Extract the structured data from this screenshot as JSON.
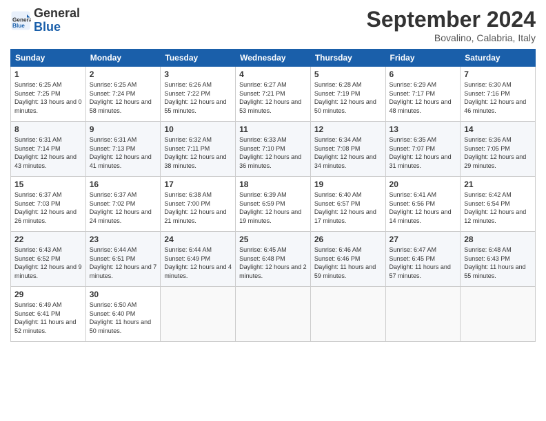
{
  "header": {
    "logo_general": "General",
    "logo_blue": "Blue",
    "month_title": "September 2024",
    "location": "Bovalino, Calabria, Italy"
  },
  "days_of_week": [
    "Sunday",
    "Monday",
    "Tuesday",
    "Wednesday",
    "Thursday",
    "Friday",
    "Saturday"
  ],
  "weeks": [
    [
      {
        "day": "1",
        "sunrise": "Sunrise: 6:25 AM",
        "sunset": "Sunset: 7:25 PM",
        "daylight": "Daylight: 13 hours and 0 minutes."
      },
      {
        "day": "2",
        "sunrise": "Sunrise: 6:25 AM",
        "sunset": "Sunset: 7:24 PM",
        "daylight": "Daylight: 12 hours and 58 minutes."
      },
      {
        "day": "3",
        "sunrise": "Sunrise: 6:26 AM",
        "sunset": "Sunset: 7:22 PM",
        "daylight": "Daylight: 12 hours and 55 minutes."
      },
      {
        "day": "4",
        "sunrise": "Sunrise: 6:27 AM",
        "sunset": "Sunset: 7:21 PM",
        "daylight": "Daylight: 12 hours and 53 minutes."
      },
      {
        "day": "5",
        "sunrise": "Sunrise: 6:28 AM",
        "sunset": "Sunset: 7:19 PM",
        "daylight": "Daylight: 12 hours and 50 minutes."
      },
      {
        "day": "6",
        "sunrise": "Sunrise: 6:29 AM",
        "sunset": "Sunset: 7:17 PM",
        "daylight": "Daylight: 12 hours and 48 minutes."
      },
      {
        "day": "7",
        "sunrise": "Sunrise: 6:30 AM",
        "sunset": "Sunset: 7:16 PM",
        "daylight": "Daylight: 12 hours and 46 minutes."
      }
    ],
    [
      {
        "day": "8",
        "sunrise": "Sunrise: 6:31 AM",
        "sunset": "Sunset: 7:14 PM",
        "daylight": "Daylight: 12 hours and 43 minutes."
      },
      {
        "day": "9",
        "sunrise": "Sunrise: 6:31 AM",
        "sunset": "Sunset: 7:13 PM",
        "daylight": "Daylight: 12 hours and 41 minutes."
      },
      {
        "day": "10",
        "sunrise": "Sunrise: 6:32 AM",
        "sunset": "Sunset: 7:11 PM",
        "daylight": "Daylight: 12 hours and 38 minutes."
      },
      {
        "day": "11",
        "sunrise": "Sunrise: 6:33 AM",
        "sunset": "Sunset: 7:10 PM",
        "daylight": "Daylight: 12 hours and 36 minutes."
      },
      {
        "day": "12",
        "sunrise": "Sunrise: 6:34 AM",
        "sunset": "Sunset: 7:08 PM",
        "daylight": "Daylight: 12 hours and 34 minutes."
      },
      {
        "day": "13",
        "sunrise": "Sunrise: 6:35 AM",
        "sunset": "Sunset: 7:07 PM",
        "daylight": "Daylight: 12 hours and 31 minutes."
      },
      {
        "day": "14",
        "sunrise": "Sunrise: 6:36 AM",
        "sunset": "Sunset: 7:05 PM",
        "daylight": "Daylight: 12 hours and 29 minutes."
      }
    ],
    [
      {
        "day": "15",
        "sunrise": "Sunrise: 6:37 AM",
        "sunset": "Sunset: 7:03 PM",
        "daylight": "Daylight: 12 hours and 26 minutes."
      },
      {
        "day": "16",
        "sunrise": "Sunrise: 6:37 AM",
        "sunset": "Sunset: 7:02 PM",
        "daylight": "Daylight: 12 hours and 24 minutes."
      },
      {
        "day": "17",
        "sunrise": "Sunrise: 6:38 AM",
        "sunset": "Sunset: 7:00 PM",
        "daylight": "Daylight: 12 hours and 21 minutes."
      },
      {
        "day": "18",
        "sunrise": "Sunrise: 6:39 AM",
        "sunset": "Sunset: 6:59 PM",
        "daylight": "Daylight: 12 hours and 19 minutes."
      },
      {
        "day": "19",
        "sunrise": "Sunrise: 6:40 AM",
        "sunset": "Sunset: 6:57 PM",
        "daylight": "Daylight: 12 hours and 17 minutes."
      },
      {
        "day": "20",
        "sunrise": "Sunrise: 6:41 AM",
        "sunset": "Sunset: 6:56 PM",
        "daylight": "Daylight: 12 hours and 14 minutes."
      },
      {
        "day": "21",
        "sunrise": "Sunrise: 6:42 AM",
        "sunset": "Sunset: 6:54 PM",
        "daylight": "Daylight: 12 hours and 12 minutes."
      }
    ],
    [
      {
        "day": "22",
        "sunrise": "Sunrise: 6:43 AM",
        "sunset": "Sunset: 6:52 PM",
        "daylight": "Daylight: 12 hours and 9 minutes."
      },
      {
        "day": "23",
        "sunrise": "Sunrise: 6:44 AM",
        "sunset": "Sunset: 6:51 PM",
        "daylight": "Daylight: 12 hours and 7 minutes."
      },
      {
        "day": "24",
        "sunrise": "Sunrise: 6:44 AM",
        "sunset": "Sunset: 6:49 PM",
        "daylight": "Daylight: 12 hours and 4 minutes."
      },
      {
        "day": "25",
        "sunrise": "Sunrise: 6:45 AM",
        "sunset": "Sunset: 6:48 PM",
        "daylight": "Daylight: 12 hours and 2 minutes."
      },
      {
        "day": "26",
        "sunrise": "Sunrise: 6:46 AM",
        "sunset": "Sunset: 6:46 PM",
        "daylight": "Daylight: 11 hours and 59 minutes."
      },
      {
        "day": "27",
        "sunrise": "Sunrise: 6:47 AM",
        "sunset": "Sunset: 6:45 PM",
        "daylight": "Daylight: 11 hours and 57 minutes."
      },
      {
        "day": "28",
        "sunrise": "Sunrise: 6:48 AM",
        "sunset": "Sunset: 6:43 PM",
        "daylight": "Daylight: 11 hours and 55 minutes."
      }
    ],
    [
      {
        "day": "29",
        "sunrise": "Sunrise: 6:49 AM",
        "sunset": "Sunset: 6:41 PM",
        "daylight": "Daylight: 11 hours and 52 minutes."
      },
      {
        "day": "30",
        "sunrise": "Sunrise: 6:50 AM",
        "sunset": "Sunset: 6:40 PM",
        "daylight": "Daylight: 11 hours and 50 minutes."
      },
      null,
      null,
      null,
      null,
      null
    ]
  ]
}
